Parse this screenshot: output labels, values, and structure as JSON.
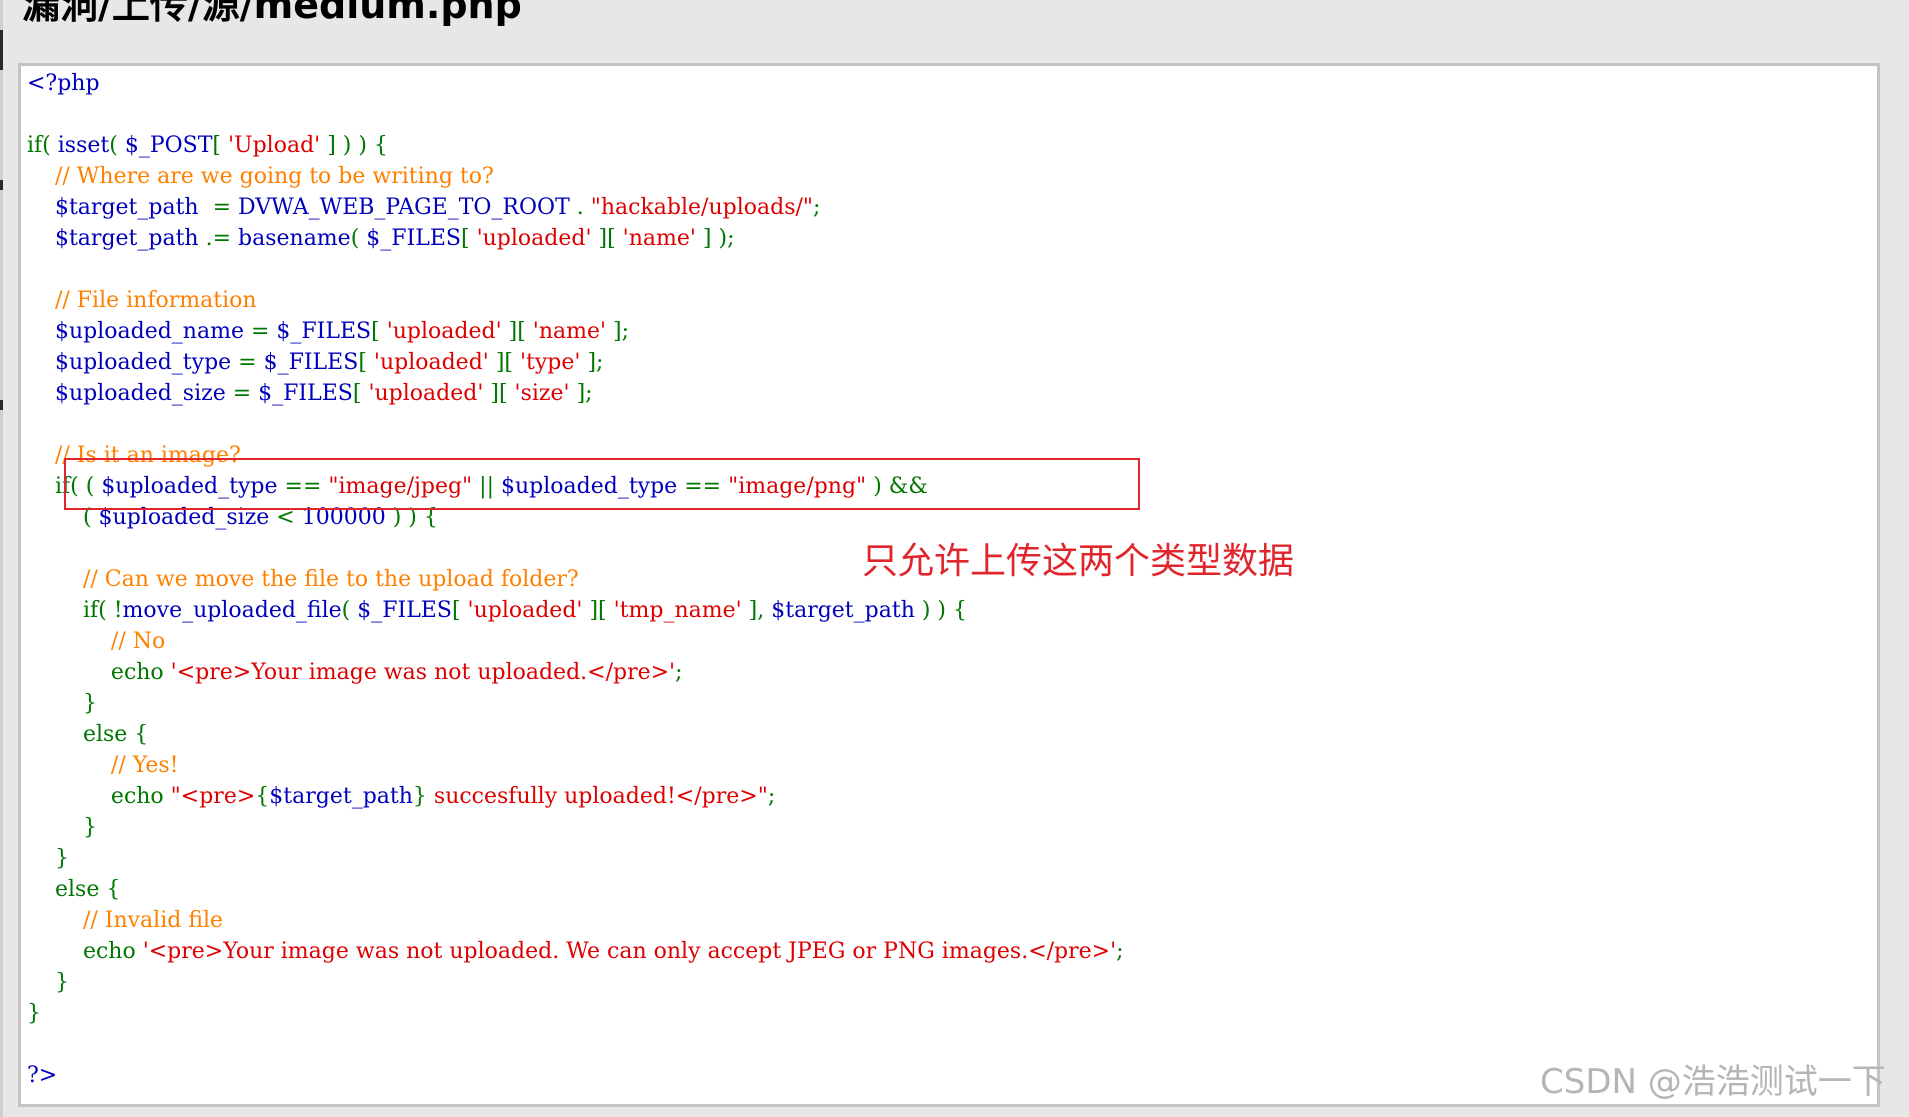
{
  "page": {
    "title": "漏洞/上传/源/medium.php",
    "annotation": "只允许上传这两个类型数据",
    "watermark": "CSDN @浩浩测试一下"
  },
  "colors": {
    "keyword": "#007700",
    "comment": "#FF8000",
    "string": "#DD0000",
    "default": "#0000BB",
    "highlight_box": "#E0262D"
  },
  "code": {
    "lines": [
      [
        {
          "t": "<?php",
          "c": "df"
        }
      ],
      [],
      [
        {
          "t": "if( ",
          "c": "kw"
        },
        {
          "t": "isset",
          "c": "df"
        },
        {
          "t": "( ",
          "c": "kw"
        },
        {
          "t": "$_POST",
          "c": "df"
        },
        {
          "t": "[ ",
          "c": "kw"
        },
        {
          "t": "'Upload'",
          "c": "st"
        },
        {
          "t": " ] ) ) {",
          "c": "kw"
        }
      ],
      [
        {
          "t": "    // Where are we going to be writing to?",
          "c": "cm"
        }
      ],
      [
        {
          "t": "    $target_path  ",
          "c": "df"
        },
        {
          "t": "= ",
          "c": "kw"
        },
        {
          "t": "DVWA_WEB_PAGE_TO_ROOT ",
          "c": "df"
        },
        {
          "t": ". ",
          "c": "kw"
        },
        {
          "t": "\"hackable/uploads/\"",
          "c": "st"
        },
        {
          "t": ";",
          "c": "kw"
        }
      ],
      [
        {
          "t": "    $target_path ",
          "c": "df"
        },
        {
          "t": ".= ",
          "c": "kw"
        },
        {
          "t": "basename",
          "c": "df"
        },
        {
          "t": "( ",
          "c": "kw"
        },
        {
          "t": "$_FILES",
          "c": "df"
        },
        {
          "t": "[ ",
          "c": "kw"
        },
        {
          "t": "'uploaded'",
          "c": "st"
        },
        {
          "t": " ][ ",
          "c": "kw"
        },
        {
          "t": "'name'",
          "c": "st"
        },
        {
          "t": " ] );",
          "c": "kw"
        }
      ],
      [],
      [
        {
          "t": "    // File information",
          "c": "cm"
        }
      ],
      [
        {
          "t": "    $uploaded_name ",
          "c": "df"
        },
        {
          "t": "= ",
          "c": "kw"
        },
        {
          "t": "$_FILES",
          "c": "df"
        },
        {
          "t": "[ ",
          "c": "kw"
        },
        {
          "t": "'uploaded'",
          "c": "st"
        },
        {
          "t": " ][ ",
          "c": "kw"
        },
        {
          "t": "'name'",
          "c": "st"
        },
        {
          "t": " ];",
          "c": "kw"
        }
      ],
      [
        {
          "t": "    $uploaded_type ",
          "c": "df"
        },
        {
          "t": "= ",
          "c": "kw"
        },
        {
          "t": "$_FILES",
          "c": "df"
        },
        {
          "t": "[ ",
          "c": "kw"
        },
        {
          "t": "'uploaded'",
          "c": "st"
        },
        {
          "t": " ][ ",
          "c": "kw"
        },
        {
          "t": "'type'",
          "c": "st"
        },
        {
          "t": " ];",
          "c": "kw"
        }
      ],
      [
        {
          "t": "    $uploaded_size ",
          "c": "df"
        },
        {
          "t": "= ",
          "c": "kw"
        },
        {
          "t": "$_FILES",
          "c": "df"
        },
        {
          "t": "[ ",
          "c": "kw"
        },
        {
          "t": "'uploaded'",
          "c": "st"
        },
        {
          "t": " ][ ",
          "c": "kw"
        },
        {
          "t": "'size'",
          "c": "st"
        },
        {
          "t": " ];",
          "c": "kw"
        }
      ],
      [],
      [
        {
          "t": "    // Is it an image?",
          "c": "cm"
        }
      ],
      [
        {
          "t": "    if( ( ",
          "c": "kw"
        },
        {
          "t": "$uploaded_type ",
          "c": "df"
        },
        {
          "t": "== ",
          "c": "kw"
        },
        {
          "t": "\"image/jpeg\" ",
          "c": "st"
        },
        {
          "t": "|| ",
          "c": "kw"
        },
        {
          "t": "$uploaded_type ",
          "c": "df"
        },
        {
          "t": "== ",
          "c": "kw"
        },
        {
          "t": "\"image/png\" ",
          "c": "st"
        },
        {
          "t": ") &&",
          "c": "kw"
        }
      ],
      [
        {
          "t": "        ( ",
          "c": "kw"
        },
        {
          "t": "$uploaded_size ",
          "c": "df"
        },
        {
          "t": "< ",
          "c": "kw"
        },
        {
          "t": "100000 ",
          "c": "df"
        },
        {
          "t": ") ) {",
          "c": "kw"
        }
      ],
      [],
      [
        {
          "t": "        // Can we move the file to the upload folder?",
          "c": "cm"
        }
      ],
      [
        {
          "t": "        if( !",
          "c": "kw"
        },
        {
          "t": "move_uploaded_file",
          "c": "df"
        },
        {
          "t": "( ",
          "c": "kw"
        },
        {
          "t": "$_FILES",
          "c": "df"
        },
        {
          "t": "[ ",
          "c": "kw"
        },
        {
          "t": "'uploaded'",
          "c": "st"
        },
        {
          "t": " ][ ",
          "c": "kw"
        },
        {
          "t": "'tmp_name'",
          "c": "st"
        },
        {
          "t": " ], ",
          "c": "kw"
        },
        {
          "t": "$target_path ",
          "c": "df"
        },
        {
          "t": ") ) {",
          "c": "kw"
        }
      ],
      [
        {
          "t": "            // No",
          "c": "cm"
        }
      ],
      [
        {
          "t": "            echo ",
          "c": "kw"
        },
        {
          "t": "'<pre>Your image was not uploaded.</pre>'",
          "c": "st"
        },
        {
          "t": ";",
          "c": "kw"
        }
      ],
      [
        {
          "t": "        }",
          "c": "kw"
        }
      ],
      [
        {
          "t": "        else {",
          "c": "kw"
        }
      ],
      [
        {
          "t": "            // Yes!",
          "c": "cm"
        }
      ],
      [
        {
          "t": "            echo ",
          "c": "kw"
        },
        {
          "t": "\"<pre>",
          "c": "st"
        },
        {
          "t": "{",
          "c": "kw"
        },
        {
          "t": "$target_path",
          "c": "df"
        },
        {
          "t": "}",
          "c": "kw"
        },
        {
          "t": " succesfully uploaded!</pre>\"",
          "c": "st"
        },
        {
          "t": ";",
          "c": "kw"
        }
      ],
      [
        {
          "t": "        }",
          "c": "kw"
        }
      ],
      [
        {
          "t": "    }",
          "c": "kw"
        }
      ],
      [
        {
          "t": "    else {",
          "c": "kw"
        }
      ],
      [
        {
          "t": "        // Invalid file",
          "c": "cm"
        }
      ],
      [
        {
          "t": "        echo ",
          "c": "kw"
        },
        {
          "t": "'<pre>Your image was not uploaded. We can only accept JPEG or PNG images.</pre>'",
          "c": "st"
        },
        {
          "t": ";",
          "c": "kw"
        }
      ],
      [
        {
          "t": "    }",
          "c": "kw"
        }
      ],
      [
        {
          "t": "}",
          "c": "kw"
        }
      ],
      [],
      [
        {
          "t": "?>",
          "c": "df"
        }
      ]
    ]
  }
}
